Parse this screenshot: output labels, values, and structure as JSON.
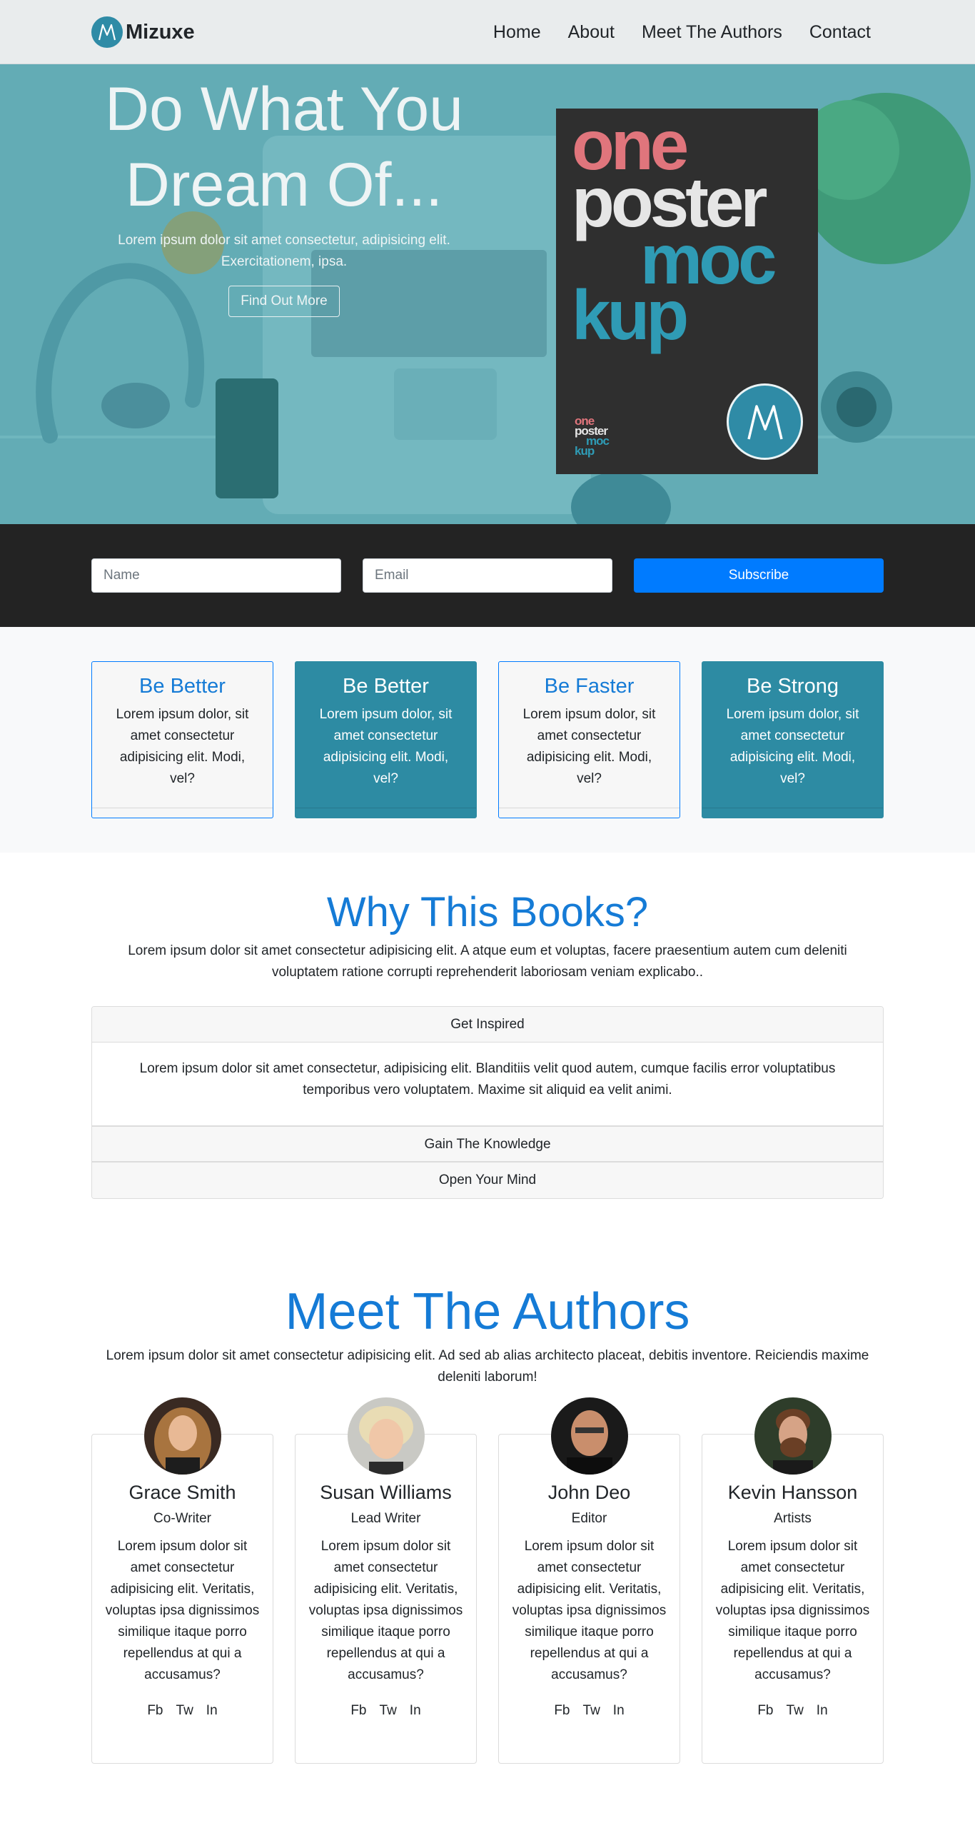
{
  "nav": {
    "brand": "Mizuxe",
    "links": [
      "Home",
      "About",
      "Meet The Authors",
      "Contact"
    ]
  },
  "hero": {
    "title_line1": "Do What You",
    "title_line2": "Dream Of...",
    "subtitle_line1": "Lorem ipsum dolor sit amet consectetur, adipisicing elit.",
    "subtitle_line2": "Exercitationem, ipsa.",
    "button": "Find Out More",
    "poster": {
      "line1": "one",
      "line2": "poster",
      "line3": "moc",
      "line4": "kup",
      "colors": {
        "one": "#e0757c",
        "poster": "#e6e6e6",
        "mockup": "#2f9bb5"
      }
    }
  },
  "subscribe": {
    "name_placeholder": "Name",
    "email_placeholder": "Email",
    "button": "Subscribe"
  },
  "features": [
    {
      "title": "Be Better",
      "text": "Lorem ipsum dolor, sit amet consectetur adipisicing elit. Modi, vel?"
    },
    {
      "title": "Be Better",
      "text": "Lorem ipsum dolor, sit amet consectetur adipisicing elit. Modi, vel?"
    },
    {
      "title": "Be Faster",
      "text": "Lorem ipsum dolor, sit amet consectetur adipisicing elit. Modi, vel?"
    },
    {
      "title": "Be Strong",
      "text": "Lorem ipsum dolor, sit amet consectetur adipisicing elit. Modi, vel?"
    }
  ],
  "why": {
    "title": "Why This Books?",
    "text": "Lorem ipsum dolor sit amet consectetur adipisicing elit. A atque eum et voluptas, facere praesentium autem cum deleniti voluptatem ratione corrupti reprehenderit laboriosam veniam explicabo..",
    "accordion": [
      {
        "title": "Get Inspired",
        "body": "Lorem ipsum dolor sit amet consectetur, adipisicing elit. Blanditiis velit quod autem, cumque facilis error voluptatibus temporibus vero voluptatem. Maxime sit aliquid ea velit animi."
      },
      {
        "title": "Gain The Knowledge"
      },
      {
        "title": "Open Your Mind"
      }
    ]
  },
  "authors": {
    "title": "Meet The Authors",
    "text": "Lorem ipsum dolor sit amet consectetur adipisicing elit. Ad sed ab alias architecto placeat, debitis inventore. Reiciendis maxime deleniti laborum!",
    "social": [
      "Fb",
      "Tw",
      "In"
    ],
    "list": [
      {
        "name": "Grace Smith",
        "role": "Co-Writer",
        "bio": "Lorem ipsum dolor sit amet consectetur adipisicing elit. Veritatis, voluptas ipsa dignissimos similique itaque porro repellendus at qui a accusamus?"
      },
      {
        "name": "Susan Williams",
        "role": "Lead Writer",
        "bio": "Lorem ipsum dolor sit amet consectetur adipisicing elit. Veritatis, voluptas ipsa dignissimos similique itaque porro repellendus at qui a accusamus?"
      },
      {
        "name": "John Deo",
        "role": "Editor",
        "bio": "Lorem ipsum dolor sit amet consectetur adipisicing elit. Veritatis, voluptas ipsa dignissimos similique itaque porro repellendus at qui a accusamus?"
      },
      {
        "name": "Kevin Hansson",
        "role": "Artists",
        "bio": "Lorem ipsum dolor sit amet consectetur adipisicing elit. Veritatis, voluptas ipsa dignissimos similique itaque porro repellendus at qui a accusamus?"
      }
    ]
  },
  "colors": {
    "accent": "#007bff",
    "heading_blue": "#157bd6",
    "teal": "#2d8ba3",
    "dark_band": "#232323"
  }
}
